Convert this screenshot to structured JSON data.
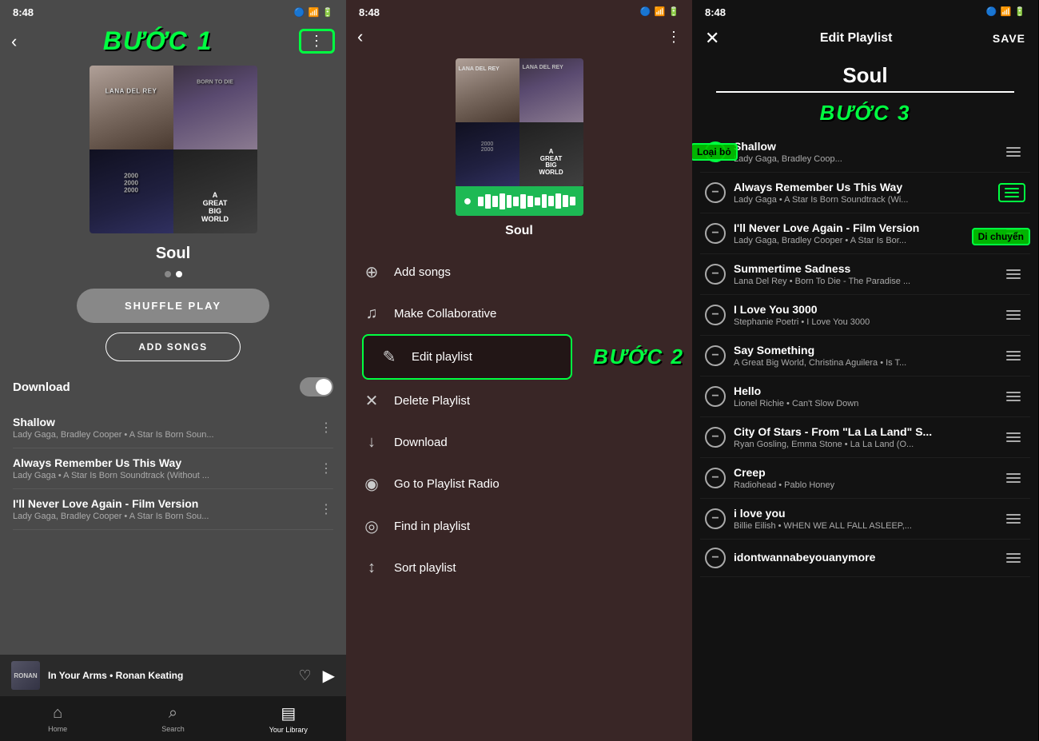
{
  "panel1": {
    "status_time": "8:48",
    "back_label": "‹",
    "buoc1_label": "BƯỚC 1",
    "playlist_title": "Soul",
    "shuffle_label": "SHUFFLE PLAY",
    "add_songs_label": "ADD SONGS",
    "download_label": "Download",
    "dots_label": "⋮",
    "songs": [
      {
        "title": "Shallow",
        "sub": "Lady Gaga, Bradley Cooper • A Star Is Born Soun..."
      },
      {
        "title": "Always Remember Us This Way",
        "sub": "Lady Gaga • A Star Is Born Soundtrack (Without ..."
      },
      {
        "title": "I'll Never Love Again - Film Version",
        "sub": "Lady Gaga, Bradley Cooper • A Star Is Born Sou..."
      }
    ],
    "now_playing_title": "In Your Arms • Ronan Keating",
    "now_playing_thumb": "RONAN",
    "nav_items": [
      {
        "label": "Home",
        "icon": "⌂"
      },
      {
        "label": "Search",
        "icon": "⌕"
      },
      {
        "label": "Your Library",
        "icon": "▤"
      }
    ]
  },
  "panel2": {
    "status_time": "8:48",
    "back_label": "‹",
    "dots_label": "⋮",
    "playlist_title": "Soul",
    "buoc2_label": "BƯỚC 2",
    "menu_items": [
      {
        "icon": "＋",
        "label": "Add songs",
        "id": "add-songs"
      },
      {
        "icon": "♫",
        "label": "Make Collaborative",
        "id": "make-collab"
      },
      {
        "icon": "✎",
        "label": "Edit playlist",
        "id": "edit-playlist",
        "highlighted": true
      },
      {
        "icon": "✕",
        "label": "Delete Playlist",
        "id": "delete-playlist"
      },
      {
        "icon": "↓",
        "label": "Download",
        "id": "download"
      },
      {
        "icon": "◉",
        "label": "Go to Playlist Radio",
        "id": "radio"
      },
      {
        "icon": "◎",
        "label": "Find in playlist",
        "id": "find"
      },
      {
        "icon": "↕",
        "label": "Sort playlist",
        "id": "sort"
      }
    ]
  },
  "panel3": {
    "status_time": "8:48",
    "close_label": "✕",
    "header_title": "Edit Playlist",
    "save_label": "SAVE",
    "playlist_name": "Soul",
    "buoc3_label": "BƯỚC 3",
    "loaibo_label": "Loại bỏ",
    "dichuy_label": "Di chuyển",
    "songs": [
      {
        "title": "Shallow",
        "sub": "Lady Gaga, Bradley Coop... Di...",
        "minus_highlighted": true
      },
      {
        "title": "Always Remember Us This Way",
        "sub": "Lady Gaga • A Star Is Born Soundtrack (Wi...",
        "drag_highlighted": true
      },
      {
        "title": "I'll Never Love Again - Film Version",
        "sub": "Lady Gaga, Bradley Cooper • A Star Is Bor..."
      },
      {
        "title": "Summertime Sadness",
        "sub": "Lana Del Rey • Born To Die - The Paradise ..."
      },
      {
        "title": "I Love You 3000",
        "sub": "Stephanie Poetri • I Love You 3000"
      },
      {
        "title": "Say Something",
        "sub": "A Great Big World, Christina Aguilera • Is T..."
      },
      {
        "title": "Hello",
        "sub": "Lionel Richie • Can't Slow Down"
      },
      {
        "title": "City Of Stars - From \"La La Land\" S...",
        "sub": "Ryan Gosling, Emma Stone • La La Land (O..."
      },
      {
        "title": "Creep",
        "sub": "Radiohead • Pablo Honey"
      },
      {
        "title": "i love you",
        "sub": "Billie Eilish • WHEN WE ALL FALL ASLEEP,..."
      },
      {
        "title": "idontwannabeyouanymore",
        "sub": ""
      }
    ]
  }
}
